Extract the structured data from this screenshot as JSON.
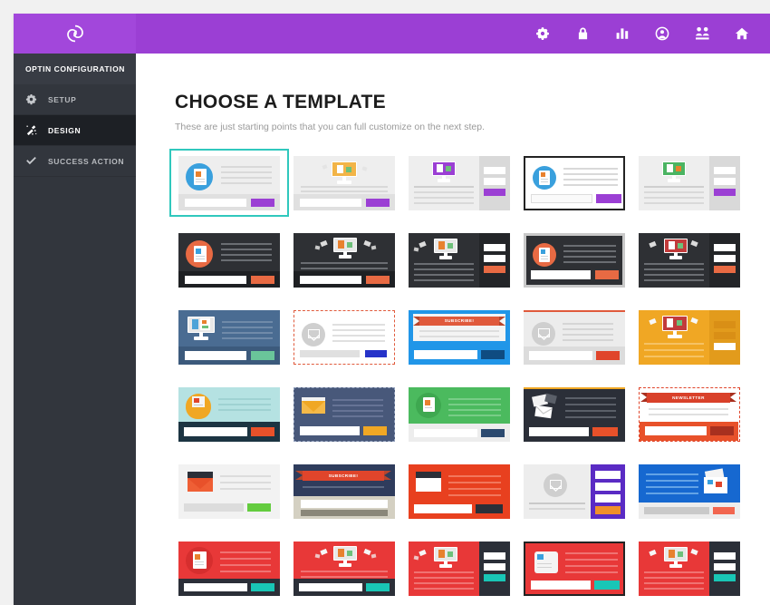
{
  "app": {
    "logo_icon": "optin-monster-logo-icon"
  },
  "topbar": {
    "background": "#9b3fd4",
    "icons": [
      {
        "name": "gear-icon",
        "label": "Settings"
      },
      {
        "name": "lock-icon",
        "label": "Security"
      },
      {
        "name": "bar-chart-icon",
        "label": "Analytics"
      },
      {
        "name": "account-icon",
        "label": "Account"
      },
      {
        "name": "users-icon",
        "label": "Subscribers"
      },
      {
        "name": "home-icon",
        "label": "Home"
      }
    ]
  },
  "sidebar": {
    "title": "OPTIN CONFIGURATION",
    "items": [
      {
        "label": "SETUP",
        "icon": "gear-icon",
        "active": false
      },
      {
        "label": "DESIGN",
        "icon": "wand-icon",
        "active": true
      },
      {
        "label": "SUCCESS ACTION",
        "icon": "check-icon",
        "active": false
      }
    ]
  },
  "main": {
    "title": "CHOOSE A TEMPLATE",
    "subtitle": "These are just starting points that you can full customize on the next step.",
    "selected_template_index": 0,
    "selection_color": "#30c8bd",
    "templates": [
      {
        "id": 1,
        "name": "light-circle-doc-purple",
        "selected": true
      },
      {
        "id": 2,
        "name": "light-monitor-purple",
        "selected": false
      },
      {
        "id": 3,
        "name": "light-monitor-sidebar-purple",
        "selected": false
      },
      {
        "id": 4,
        "name": "light-monitor-sidebar-purple-2",
        "selected": false
      },
      {
        "id": 5,
        "name": "light-monitor-green-sidebar",
        "selected": false
      },
      {
        "id": 6,
        "name": "dark-circle-doc-orange",
        "selected": false
      },
      {
        "id": 7,
        "name": "dark-monitor-orange",
        "selected": false
      },
      {
        "id": 8,
        "name": "dark-monitor-sidebar-orange",
        "selected": false
      },
      {
        "id": 9,
        "name": "dark-monitor-sidebar-orange-2",
        "selected": false
      },
      {
        "id": 10,
        "name": "dark-circle-doc-orange-framed",
        "selected": false
      },
      {
        "id": 11,
        "name": "dark-monitor-red-sidebar",
        "selected": false
      },
      {
        "id": 12,
        "name": "blue-monitor-green-button",
        "selected": false
      },
      {
        "id": 13,
        "name": "dashed-envelope-blue-button",
        "selected": false
      },
      {
        "id": 14,
        "name": "blue-subscribe-ribbon",
        "selected": false
      },
      {
        "id": 15,
        "name": "grey-envelope-red-button",
        "selected": false
      },
      {
        "id": 16,
        "name": "orange-monitor-sidebar",
        "selected": false
      },
      {
        "id": 17,
        "name": "teal-envelope-dark-bar",
        "selected": false
      },
      {
        "id": 18,
        "name": "navy-envelope-yellow-button",
        "selected": false
      },
      {
        "id": 19,
        "name": "green-doc-navy-button",
        "selected": false
      },
      {
        "id": 20,
        "name": "dark-letters-orange-button",
        "selected": false
      },
      {
        "id": 21,
        "name": "newsletter-ribbon-red",
        "selected": false
      },
      {
        "id": 22,
        "name": "light-envelope-green-button",
        "selected": false
      },
      {
        "id": 23,
        "name": "navy-subscribe-ribbon",
        "selected": false
      },
      {
        "id": 24,
        "name": "red-envelope-sidebar",
        "selected": false
      },
      {
        "id": 25,
        "name": "grey-envelope-purple-sidebar",
        "selected": false
      },
      {
        "id": 26,
        "name": "blue-letters-red-button",
        "selected": false
      },
      {
        "id": 27,
        "name": "red-circle-doc-teal",
        "selected": false
      },
      {
        "id": 28,
        "name": "red-monitor-teal",
        "selected": false
      },
      {
        "id": 29,
        "name": "red-monitor-dark-sidebar",
        "selected": false
      },
      {
        "id": 30,
        "name": "red-doc-teal-framed",
        "selected": false
      },
      {
        "id": 31,
        "name": "red-monitor-dark-sidebar-2",
        "selected": false
      }
    ],
    "ribbon_labels": {
      "subscribe_blue": "SUBSCRIBE!",
      "subscribe_navy": "SUBSCRIBE!",
      "newsletter": "NEWSLETTER"
    }
  }
}
